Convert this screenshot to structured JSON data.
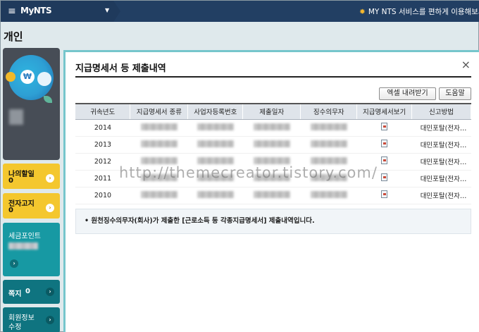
{
  "header": {
    "brand": "MyNTS",
    "notice": "MY NTS 서비스를 편하게 이용해보세요"
  },
  "page_title": "개인",
  "sidebar": {
    "my_discount": {
      "label": "나의할일",
      "count": "0"
    },
    "e_notice": {
      "label": "전자고지",
      "count": "0"
    },
    "tax_points": {
      "label": "세금포인트"
    },
    "messages": {
      "label": "쪽지",
      "count": "0"
    },
    "member_edit": {
      "label_line1": "회원정보",
      "label_line2": "수정"
    }
  },
  "panel": {
    "title": "지급명세서 등 제출내역",
    "close": "×",
    "excel_button": "엑셀 내려받기",
    "help_button": "도움말",
    "columns": [
      "귀속년도",
      "지급명세서 종류",
      "사업자등록번호",
      "제출일자",
      "징수의무자",
      "지급명세서보기",
      "신고방법"
    ],
    "rows": [
      {
        "year": "2014",
        "method": "대민포탈(전자…"
      },
      {
        "year": "2013",
        "method": "대민포탈(전자…"
      },
      {
        "year": "2012",
        "method": "대민포탈(전자…"
      },
      {
        "year": "2011",
        "method": "대민포탈(전자…"
      },
      {
        "year": "2010",
        "method": "대민포탈(전자…"
      }
    ],
    "note": "• 원천징수의무자(회사)가 제출한 [근로소득 등 각종지급명세서] 제출내역입니다."
  },
  "watermark": "http://themecreator.tistory.com/"
}
